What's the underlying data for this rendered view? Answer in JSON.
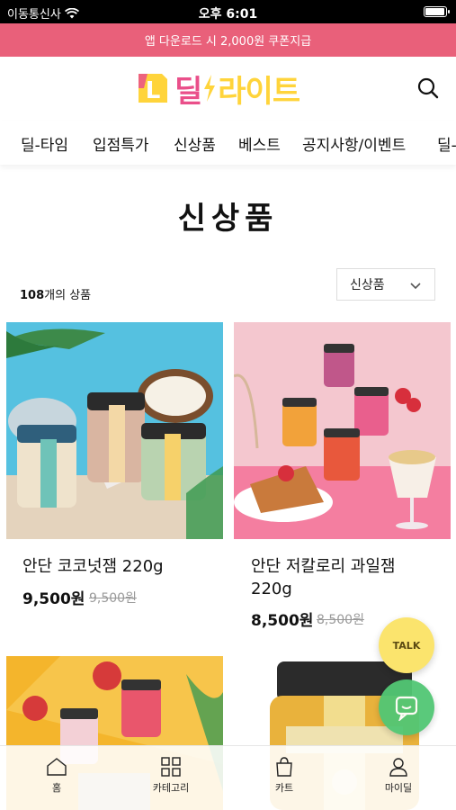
{
  "status_bar": {
    "carrier": "이동통신사",
    "time": "오후 6:01",
    "battery_level": 0.95
  },
  "promo_banner": {
    "text": "앱 다운로드 시 2,000원 쿠폰지급"
  },
  "header": {
    "logo_letter": "L",
    "logo_text_1": "딜",
    "logo_text_2": "라이트"
  },
  "nav": {
    "items": [
      "딜-타임",
      "입점특가",
      "신상품",
      "베스트",
      "공지사항/이벤트",
      "딜-"
    ]
  },
  "page": {
    "title": "신상품"
  },
  "listing": {
    "count_number": "108",
    "count_suffix": "개의 상품",
    "sort_selected": "신상품"
  },
  "products": [
    {
      "name": "안단 코코넛잼 220g",
      "price": "9,500원",
      "original_price": "9,500원"
    },
    {
      "name": "안단 저칼로리 과일잼 220g",
      "price": "8,500원",
      "original_price": "8,500원"
    }
  ],
  "floating": {
    "talk_label": "TALK"
  },
  "tabbar": {
    "items": [
      "홈",
      "카테고리",
      "카트",
      "마이딜"
    ]
  },
  "colors": {
    "promo": "#e9607a",
    "logo_yellow": "#ffd43b",
    "logo_pink": "#ea4f8a",
    "talk": "#fbe46d",
    "chat": "#52c774"
  },
  "icons": [
    "wifi-icon",
    "battery-icon",
    "search-icon",
    "chevron-down-icon",
    "talk-icon",
    "chat-icon",
    "home-icon",
    "category-icon",
    "cart-icon",
    "user-icon"
  ]
}
